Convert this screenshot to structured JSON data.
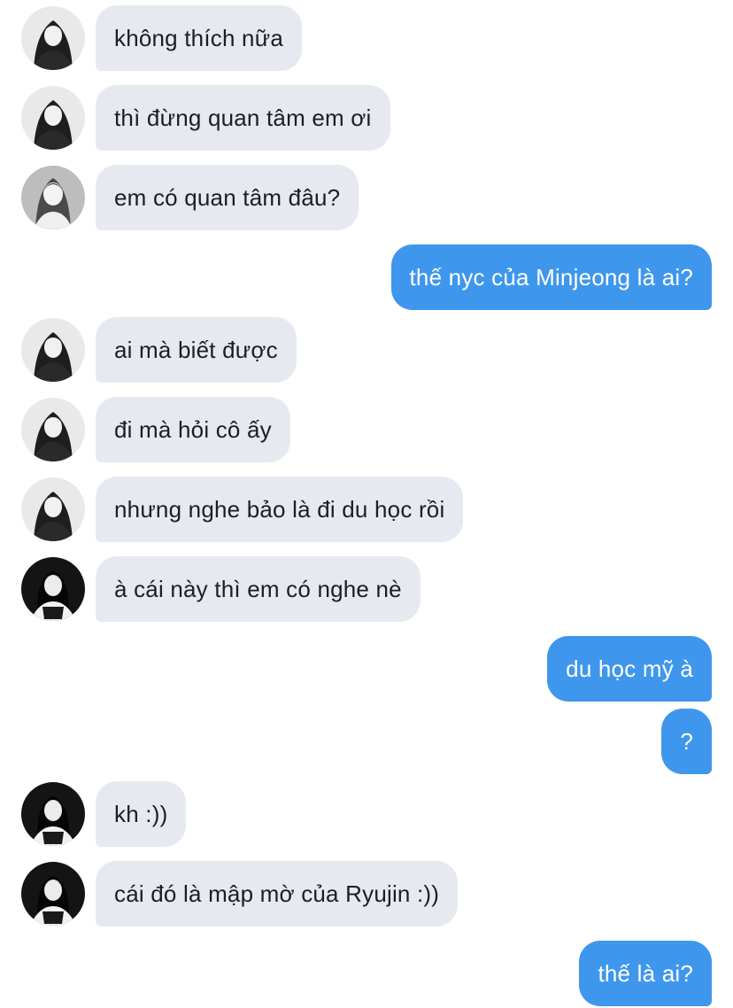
{
  "colors": {
    "incoming_bubble": "#e6eaf0",
    "outgoing_bubble": "#3e97ec",
    "background": "#ffffff"
  },
  "messages": [
    {
      "sender": "other",
      "avatar": "avatar-girl-long-dark-hair-icon",
      "text": "không thích nữa"
    },
    {
      "sender": "other",
      "avatar": "avatar-girl-long-dark-hair-icon",
      "text": "thì đừng quan tâm em ơi"
    },
    {
      "sender": "other",
      "avatar": "avatar-girl-light-portrait-icon",
      "text": "em có quan tâm đâu?"
    },
    {
      "sender": "me",
      "text": "thế nyc của Minjeong là ai?"
    },
    {
      "sender": "other",
      "avatar": "avatar-girl-long-dark-hair-icon",
      "text": "ai mà biết được"
    },
    {
      "sender": "other",
      "avatar": "avatar-girl-long-dark-hair-icon",
      "text": "đi mà hỏi cô ấy"
    },
    {
      "sender": "other",
      "avatar": "avatar-girl-long-dark-hair-icon",
      "text": "nhưng nghe bảo là đi du học rồi"
    },
    {
      "sender": "other",
      "avatar": "avatar-girl-dark-background-icon",
      "text": "à cái này thì em có nghe nè"
    },
    {
      "sender": "me",
      "text": "du học mỹ à"
    },
    {
      "sender": "me",
      "text": "?"
    },
    {
      "sender": "other",
      "avatar": "avatar-girl-dark-background-icon",
      "text": "kh :))"
    },
    {
      "sender": "other",
      "avatar": "avatar-girl-dark-background-icon",
      "text": "cái đó là mập mờ của Ryujin :))"
    },
    {
      "sender": "me",
      "text": "thế là ai?"
    }
  ]
}
